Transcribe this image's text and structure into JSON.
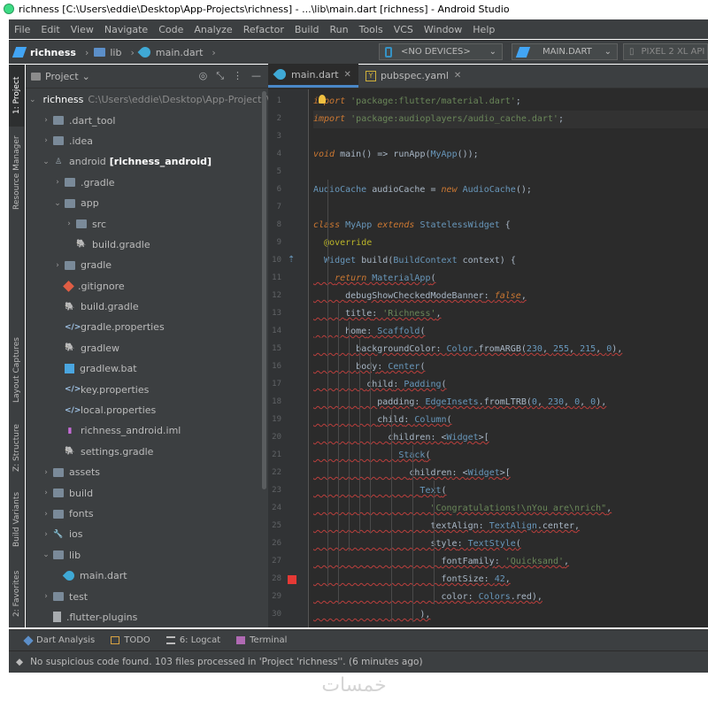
{
  "window": {
    "title": "richness [C:\\Users\\eddie\\Desktop\\App-Projects\\richness] - ...\\lib\\main.dart [richness] - Android Studio"
  },
  "menu": [
    "File",
    "Edit",
    "View",
    "Navigate",
    "Code",
    "Analyze",
    "Refactor",
    "Build",
    "Run",
    "Tools",
    "VCS",
    "Window",
    "Help"
  ],
  "breadcrumb": {
    "project": "richness",
    "folder": "lib",
    "file": "main.dart"
  },
  "toolbar": {
    "device": "<NO DEVICES>",
    "run_config": "MAIN.DART",
    "emulator": "PIXEL 2 XL API"
  },
  "side_tabs": [
    "1: Project",
    "Resource Manager",
    "Layout Captures",
    "Z: Structure",
    "Build Variants",
    "2: Favorites"
  ],
  "project_panel": {
    "title": "Project",
    "tree": [
      {
        "label": "richness",
        "extra": "C:\\Users\\eddie\\Desktop\\App-Projects\\richness",
        "bold": "",
        "arrow": "v",
        "icon": "folder-icon",
        "depth": 0
      },
      {
        "label": ".dart_tool",
        "extra": "",
        "bold": "",
        "arrow": ">",
        "icon": "folder-icon",
        "depth": 1
      },
      {
        "label": ".idea",
        "extra": "",
        "bold": "",
        "arrow": ">",
        "icon": "folder-icon",
        "depth": 1
      },
      {
        "label": "android",
        "extra": "",
        "bold": "[richness_android]",
        "arrow": "v",
        "icon": "android-folder-icon",
        "depth": 1
      },
      {
        "label": ".gradle",
        "extra": "",
        "bold": "",
        "arrow": ">",
        "icon": "folder-icon",
        "depth": 2
      },
      {
        "label": "app",
        "extra": "",
        "bold": "",
        "arrow": "v",
        "icon": "folder-icon",
        "depth": 2
      },
      {
        "label": "src",
        "extra": "",
        "bold": "",
        "arrow": ">",
        "icon": "folder-icon",
        "depth": 3
      },
      {
        "label": "build.gradle",
        "extra": "",
        "bold": "",
        "arrow": "",
        "icon": "gradle-icon",
        "depth": 3
      },
      {
        "label": "gradle",
        "extra": "",
        "bold": "",
        "arrow": ">",
        "icon": "folder-icon",
        "depth": 2
      },
      {
        "label": ".gitignore",
        "extra": "",
        "bold": "",
        "arrow": "",
        "icon": "git-icon",
        "depth": 2
      },
      {
        "label": "build.gradle",
        "extra": "",
        "bold": "",
        "arrow": "",
        "icon": "gradle-icon",
        "depth": 2
      },
      {
        "label": "gradle.properties",
        "extra": "",
        "bold": "",
        "arrow": "",
        "icon": "properties-icon",
        "depth": 2
      },
      {
        "label": "gradlew",
        "extra": "",
        "bold": "",
        "arrow": "",
        "icon": "gradle-icon",
        "depth": 2
      },
      {
        "label": "gradlew.bat",
        "extra": "",
        "bold": "",
        "arrow": "",
        "icon": "windows-icon",
        "depth": 2
      },
      {
        "label": "key.properties",
        "extra": "",
        "bold": "",
        "arrow": "",
        "icon": "properties-icon",
        "depth": 2
      },
      {
        "label": "local.properties",
        "extra": "",
        "bold": "",
        "arrow": "",
        "icon": "properties-icon",
        "depth": 2
      },
      {
        "label": "richness_android.iml",
        "extra": "",
        "bold": "",
        "arrow": "",
        "icon": "iml-icon",
        "depth": 2
      },
      {
        "label": "settings.gradle",
        "extra": "",
        "bold": "",
        "arrow": "",
        "icon": "gradle-icon",
        "depth": 2
      },
      {
        "label": "assets",
        "extra": "",
        "bold": "",
        "arrow": ">",
        "icon": "folder-icon",
        "depth": 1
      },
      {
        "label": "build",
        "extra": "",
        "bold": "",
        "arrow": ">",
        "icon": "folder-icon",
        "depth": 1
      },
      {
        "label": "fonts",
        "extra": "",
        "bold": "",
        "arrow": ">",
        "icon": "folder-icon",
        "depth": 1
      },
      {
        "label": "ios",
        "extra": "",
        "bold": "",
        "arrow": ">",
        "icon": "wrench-folder-icon",
        "depth": 1
      },
      {
        "label": "lib",
        "extra": "",
        "bold": "",
        "arrow": "v",
        "icon": "folder-icon",
        "depth": 1
      },
      {
        "label": "main.dart",
        "extra": "",
        "bold": "",
        "arrow": "",
        "icon": "dart-icon",
        "depth": 2
      },
      {
        "label": "test",
        "extra": "",
        "bold": "",
        "arrow": ">",
        "icon": "folder-icon",
        "depth": 1
      },
      {
        "label": ".flutter-plugins",
        "extra": "",
        "bold": "",
        "arrow": "",
        "icon": "file-icon",
        "depth": 1
      }
    ]
  },
  "editor": {
    "tabs": [
      {
        "label": "main.dart",
        "active": true
      },
      {
        "label": "pubspec.yaml",
        "active": false
      }
    ],
    "line_numbers": [
      "1",
      "2",
      "3",
      "4",
      "5",
      "6",
      "7",
      "8",
      "9",
      "10",
      "11",
      "12",
      "13",
      "14",
      "15",
      "16",
      "17",
      "18",
      "19",
      "20",
      "21",
      "22",
      "23",
      "24",
      "25",
      "26",
      "27",
      "28",
      "29",
      "30"
    ],
    "lines": [
      "import 'package:flutter/material.dart';",
      "import 'package:audioplayers/audio_cache.dart';",
      "",
      "void main() => runApp(MyApp());",
      "",
      "AudioCache audioCache = new AudioCache();",
      "",
      "class MyApp extends StatelessWidget {",
      "  @override",
      "  Widget build(BuildContext context) {",
      "    return MaterialApp(",
      "      debugShowCheckedModeBanner: false,",
      "      title: 'Richness',",
      "      home: Scaffold(",
      "        backgroundColor: Color.fromARGB(230, 255, 215, 0),",
      "        body: Center(",
      "          child: Padding(",
      "            padding: EdgeInsets.fromLTRB(0, 230, 0, 0),",
      "            child: Column(",
      "              children: <Widget>[",
      "                Stack(",
      "                  children: <Widget>[",
      "                    Text(",
      "                      \"Congratulations!\\nYou are\\nrich\",",
      "                      textAlign: TextAlign.center,",
      "                      style: TextStyle(",
      "                        fontFamily: 'Quicksand',",
      "                        fontSize: 42,",
      "                        color: Colors.red),",
      "                    ),"
    ]
  },
  "bottom_tools": [
    "Dart Analysis",
    "TODO",
    "6: Logcat",
    "Terminal"
  ],
  "status": {
    "message": "No suspicious code found. 103 files processed in 'Project 'richness''. (6 minutes ago)"
  },
  "watermark": "خمسات",
  "colors": {
    "accent": "#4a88c7",
    "error_marker": "#e53935",
    "flutter_blue": "#42a5f5"
  }
}
